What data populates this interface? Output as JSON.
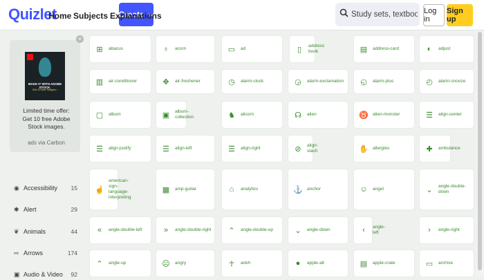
{
  "header": {
    "logo": "Quizlet",
    "nav": [
      "Home",
      "Subjects",
      "Explanations"
    ],
    "create_label": "Create",
    "search_placeholder": "Study sets, textbooks, ...",
    "login_label": "Log in",
    "signup_label": "Sign up",
    "accent_color": "#4255ff",
    "signup_color": "#ffcd1f"
  },
  "ad": {
    "image_line1": "MAKE IT WITH ADOBE STOCK.",
    "image_line2": "Get 10 free images ›",
    "text": "Limited time offer: Get 10 free Adobe Stock images.",
    "via": "ads via Carbon",
    "close_glyph": "×"
  },
  "sidebar": {
    "categories": [
      {
        "icon": "accessibility-icon",
        "glyph": "◉",
        "label": "Accessibility",
        "count": "15"
      },
      {
        "icon": "alert-icon",
        "glyph": "✱",
        "label": "Alert",
        "count": "29"
      },
      {
        "icon": "animals-icon",
        "glyph": "❦",
        "label": "Animals",
        "count": "44"
      },
      {
        "icon": "arrows-icon",
        "glyph": "⇨",
        "label": "Arrows",
        "count": "174"
      },
      {
        "icon": "audio-video-icon",
        "glyph": "▣",
        "label": "Audio & Video",
        "count": "92"
      }
    ]
  },
  "icons": {
    "accent_color": "#3b8a2f",
    "rows": [
      [
        {
          "label": "abacus",
          "glyph": "⊞",
          "icon": "abacus-icon"
        },
        {
          "label": "acorn",
          "glyph": "♁",
          "icon": "acorn-icon"
        },
        {
          "label": "ad",
          "glyph": "▭",
          "icon": "ad-icon"
        },
        {
          "label": "address book",
          "glyph": "▯",
          "icon": "address-book-icon"
        },
        {
          "label": "address-card",
          "glyph": "▤",
          "icon": "address-card-icon"
        },
        {
          "label": "adjust",
          "glyph": "◐",
          "icon": "adjust-icon"
        }
      ],
      [
        {
          "label": "air-conditioner",
          "glyph": "▥",
          "icon": "air-conditioner-icon"
        },
        {
          "label": "air-freshener",
          "glyph": "✥",
          "icon": "air-freshener-icon"
        },
        {
          "label": "alarm-clock",
          "glyph": "◷",
          "icon": "alarm-clock-icon"
        },
        {
          "label": "alarm-exclamation",
          "glyph": "◶",
          "icon": "alarm-exclamation-icon"
        },
        {
          "label": "alarm-plus",
          "glyph": "◵",
          "icon": "alarm-plus-icon"
        },
        {
          "label": "alarm-snooze",
          "glyph": "◴",
          "icon": "alarm-snooze-icon"
        }
      ],
      [
        {
          "label": "album",
          "glyph": "▢",
          "icon": "album-icon"
        },
        {
          "label": "album-collection",
          "glyph": "▣",
          "icon": "album-collection-icon"
        },
        {
          "label": "alicorn",
          "glyph": "♞",
          "icon": "alicorn-icon"
        },
        {
          "label": "alien",
          "glyph": "☊",
          "icon": "alien-icon"
        },
        {
          "label": "alien-monster",
          "glyph": "♉",
          "icon": "alien-monster-icon"
        },
        {
          "label": "align-center",
          "glyph": "☰",
          "icon": "align-center-icon"
        }
      ],
      [
        {
          "label": "align-justify",
          "glyph": "☰",
          "icon": "align-justify-icon"
        },
        {
          "label": "align-left",
          "glyph": "☰",
          "icon": "align-left-icon"
        },
        {
          "label": "align-right",
          "glyph": "☰",
          "icon": "align-right-icon"
        },
        {
          "label": "align-slash",
          "glyph": "⊘",
          "icon": "align-slash-icon"
        },
        {
          "label": "allergies",
          "glyph": "✋",
          "icon": "allergies-icon"
        },
        {
          "label": "ambulance",
          "glyph": "✚",
          "icon": "ambulance-icon"
        }
      ],
      [
        {
          "label": "american-sign-language-interpreting",
          "glyph": "☝",
          "icon": "asl-interpreting-icon"
        },
        {
          "label": "amp-guitar",
          "glyph": "▦",
          "icon": "amp-guitar-icon"
        },
        {
          "label": "analytics",
          "glyph": "⌂",
          "icon": "analytics-icon"
        },
        {
          "label": "anchor",
          "glyph": "⚓",
          "icon": "anchor-icon"
        },
        {
          "label": "angel",
          "glyph": "☺",
          "icon": "angel-icon"
        },
        {
          "label": "angle-double-down",
          "glyph": "⌄",
          "icon": "angle-double-down-icon"
        }
      ],
      [
        {
          "label": "angle-double-left",
          "glyph": "«",
          "icon": "angle-double-left-icon"
        },
        {
          "label": "angle-double-right",
          "glyph": "»",
          "icon": "angle-double-right-icon"
        },
        {
          "label": "angle-double-up",
          "glyph": "⌃",
          "icon": "angle-double-up-icon"
        },
        {
          "label": "angle-down",
          "glyph": "⌄",
          "icon": "angle-down-icon"
        },
        {
          "label": "angle-left",
          "glyph": "‹",
          "icon": "angle-left-icon"
        },
        {
          "label": "angle-right",
          "glyph": "›",
          "icon": "angle-right-icon"
        }
      ],
      [
        {
          "label": "angle-up",
          "glyph": "⌃",
          "icon": "angle-up-icon"
        },
        {
          "label": "angry",
          "glyph": "☹",
          "icon": "angry-icon"
        },
        {
          "label": "ankh",
          "glyph": "☥",
          "icon": "ankh-icon"
        },
        {
          "label": "apple-alt",
          "glyph": "●",
          "icon": "apple-alt-icon"
        },
        {
          "label": "apple-crate",
          "glyph": "▤",
          "icon": "apple-crate-icon"
        },
        {
          "label": "archive",
          "glyph": "▭",
          "icon": "archive-icon"
        }
      ]
    ]
  }
}
